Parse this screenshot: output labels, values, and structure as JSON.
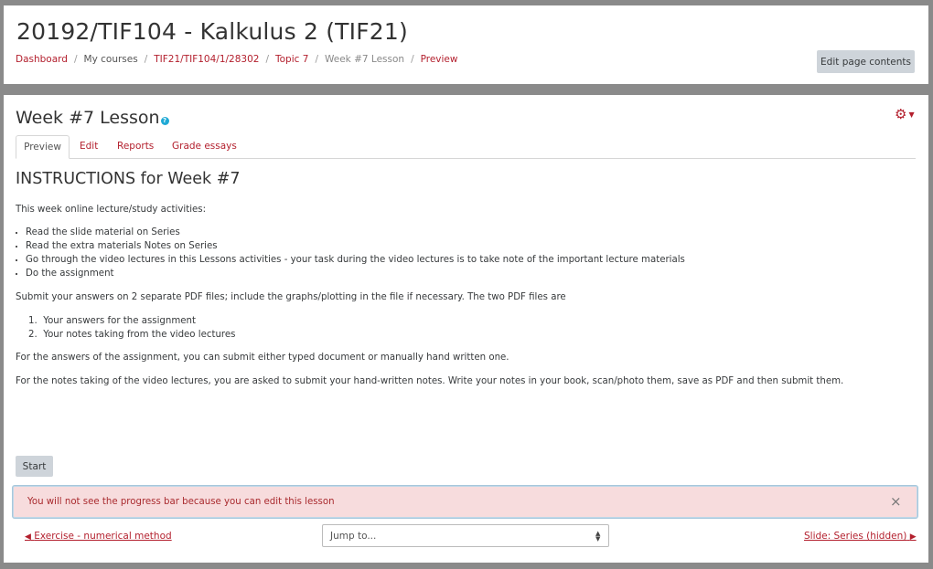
{
  "header": {
    "course_title": "20192/TIF104 - Kalkulus 2 (TIF21)",
    "breadcrumb": [
      "Dashboard",
      "My courses",
      "TIF21/TIF104/1/28302",
      "Topic 7",
      "Week #7 Lesson",
      "Preview"
    ],
    "edit_page_label": "Edit page contents"
  },
  "lesson": {
    "title": "Week #7 Lesson",
    "help_icon": "question-circle-icon",
    "settings_icon": "gear-icon",
    "tabs": [
      "Preview",
      "Edit",
      "Reports",
      "Grade essays"
    ],
    "heading": "INSTRUCTIONS for Week #7",
    "intro": "This week online lecture/study activities:",
    "activities": [
      "Read the slide material on Series",
      "Read the extra materials Notes on Series",
      "Go through the video lectures in this Lessons activities - your task during the video lectures is to take note of the important lecture materials",
      "Do the assignment"
    ],
    "submit_text": "Submit your answers on 2 separate PDF files; include the graphs/plotting in the file if necessary. The two PDF files are",
    "pdf_files": [
      "Your answers for the assignment",
      "Your notes taking from the video lectures"
    ],
    "answers_note": "For the answers of the assignment, you can submit either typed document or manually hand written one.",
    "notes_note": "For the notes taking of the video lectures, you are asked to submit your hand-written notes. Write your notes in your book, scan/photo them, save as PDF and then submit them.",
    "start_label": "Start",
    "alert_text": "You will not see the progress bar because you can edit this lesson",
    "close_symbol": "×"
  },
  "navigation": {
    "prev_label": "Exercise - numerical method",
    "jump_placeholder": "Jump to...",
    "next_label": "Slide: Series (hidden)"
  },
  "colors": {
    "accent": "#b31f2d",
    "alert_bg": "#f7dcdd",
    "button_bg": "#ced4da",
    "page_bg": "#8a8a8a"
  }
}
